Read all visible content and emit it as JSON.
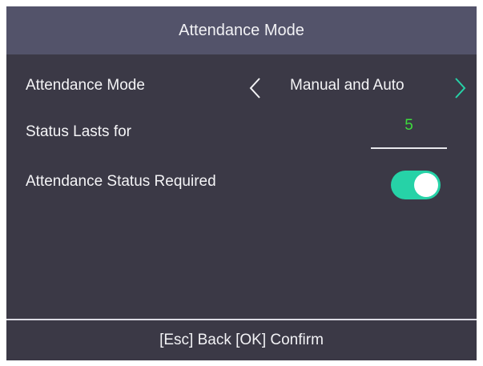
{
  "header": {
    "title": "Attendance Mode"
  },
  "settings": {
    "attendance_mode": {
      "label": "Attendance Mode",
      "value": "Manual and Auto",
      "prev_icon": "chevron-left-icon",
      "next_icon": "chevron-right-icon"
    },
    "status_lasts_for": {
      "label": "Status Lasts for",
      "value": "5"
    },
    "attendance_status_required": {
      "label": "Attendance Status Required",
      "enabled": true
    }
  },
  "footer": {
    "hint": "[Esc] Back [OK] Confirm"
  },
  "colors": {
    "background": "#3b3946",
    "header": "#53536a",
    "accent": "#26d2a7",
    "value_green": "#3ddc3d"
  }
}
